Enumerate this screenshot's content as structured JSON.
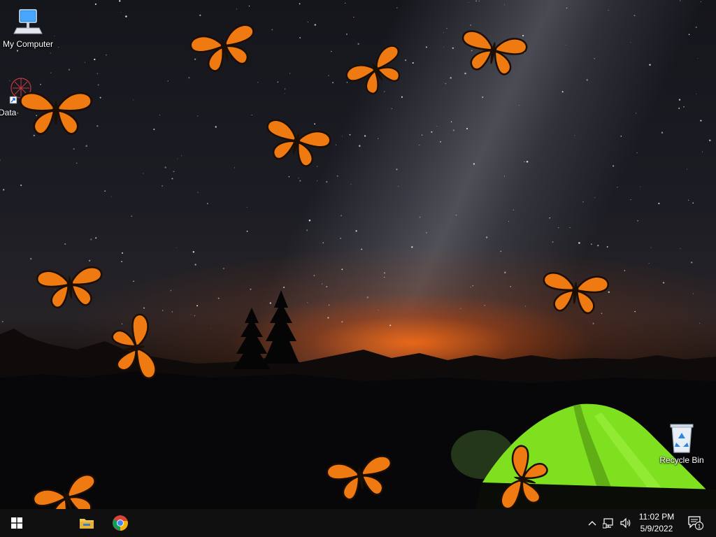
{
  "desktop": {
    "icons": [
      {
        "label": "My Computer",
        "icon": "computer-icon"
      },
      {
        "label": "Data",
        "icon": "shortcut-icon"
      },
      {
        "label": "Recycle Bin",
        "icon": "recycle-bin-icon"
      }
    ]
  },
  "taskbar": {
    "start_icon": "windows-logo-icon",
    "pinned": [
      {
        "name": "File Explorer",
        "icon": "folder-icon"
      },
      {
        "name": "Google Chrome",
        "icon": "chrome-icon"
      }
    ],
    "tray": {
      "chevron_icon": "chevron-up-icon",
      "network_icon": "network-icon",
      "volume_icon": "volume-icon",
      "time": "11:02 PM",
      "date": "5/9/2022",
      "notification_icon": "action-center-icon",
      "notification_count": "1"
    }
  },
  "colors": {
    "butterfly_orange": "#f07a12",
    "tent_green": "#7fe020",
    "taskbar": "#101010"
  }
}
